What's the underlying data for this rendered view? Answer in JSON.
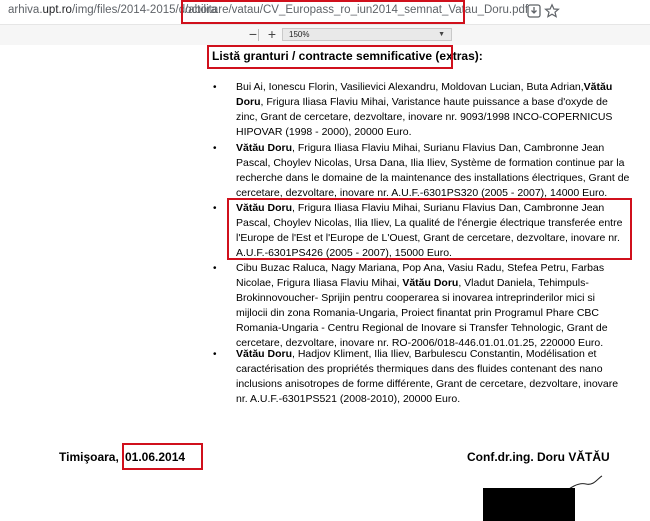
{
  "browser": {
    "url_host_plain": "arhiva.",
    "url_host_bold": "upt.ro",
    "url_path_plain": "/img/files/2014-2015/doctora",
    "url_path_highlighted": "/abilitare/vatau/CV_Europass_ro_iun2014_semnat_Vatau_Doru.pdf",
    "icons": [
      "download-icon",
      "star-icon"
    ]
  },
  "pdf_toolbar": {
    "zoom_out": "−",
    "zoom_in": "+",
    "zoom_value": "150%"
  },
  "document": {
    "heading": "Listă granturi / contracte semnificative (extras):",
    "grants": [
      {
        "lines": [
          [
            {
              "t": "Bui Ai, Ionescu Florin, Vasilievici Alexandru, Moldovan Lucian, Buta Adrian,",
              "b": false
            },
            {
              "t": "Vătău",
              "b": true
            }
          ],
          [
            {
              "t": "Doru",
              "b": true
            },
            {
              "t": ", Frigura Iliasa Flaviu Mihai, Varistance haute puissance a base d'oxyde de",
              "b": false
            }
          ],
          [
            {
              "t": "zinc, Grant de cercetare, dezvoltare, inovare nr. 9093/1998 INCO-COPERNICUS",
              "b": false
            }
          ],
          [
            {
              "t": "HIPOVAR (1998 - 2000), 20000 Euro.",
              "b": false
            }
          ]
        ]
      },
      {
        "lines": [
          [
            {
              "t": "Vătău Doru",
              "b": true
            },
            {
              "t": ", Frigura Iliasa Flaviu Mihai, Surianu Flavius Dan, Cambronne Jean",
              "b": false
            }
          ],
          [
            {
              "t": "Pascal, Choylev Nicolas, Ursa Dana, Ilia Iliev, Système de formation continue par la",
              "b": false
            }
          ],
          [
            {
              "t": "recherche dans le domaine de la maintenance des installations électriques, Grant de",
              "b": false
            }
          ],
          [
            {
              "t": "cercetare, dezvoltare, inovare nr.  A.U.F.-6301PS320 (2005 - 2007), 14000 Euro.",
              "b": false
            }
          ]
        ]
      },
      {
        "lines": [
          [
            {
              "t": "Vătău Doru",
              "b": true
            },
            {
              "t": ", Frigura Iliasa Flaviu Mihai, Surianu Flavius Dan, Cambronne Jean",
              "b": false
            }
          ],
          [
            {
              "t": "Pascal, Choylev Nicolas, Ilia Iliev, La qualité de l'énergie électrique transferée entre",
              "b": false
            }
          ],
          [
            {
              "t": "l'Europe de l'Est et l'Europe de L'Ouest, Grant de cercetare, dezvoltare, inovare nr.",
              "b": false
            }
          ],
          [
            {
              "t": "A.U.F.-6301PS426 (2005 - 2007), 15000 Euro.",
              "b": false
            }
          ]
        ]
      },
      {
        "lines": [
          [
            {
              "t": "Cibu Buzac Raluca, Nagy Mariana, Pop Ana, Vasiu Radu, Stefea Petru, Farbas",
              "b": false
            }
          ],
          [
            {
              "t": "Nicolae, Frigura Iliasa Flaviu Mihai, ",
              "b": false
            },
            {
              "t": "Vătău Doru",
              "b": true
            },
            {
              "t": ", Vladut Daniela, Tehimpuls-",
              "b": false
            }
          ],
          [
            {
              "t": "Brokinnovoucher- Sprijin pentru cooperarea si inovarea intreprinderilor mici si",
              "b": false
            }
          ],
          [
            {
              "t": "mijlocii din zona Romania-Ungaria, Proiect finantat prin Programul Phare CBC",
              "b": false
            }
          ],
          [
            {
              "t": "Romania-Ungaria - Centru Regional de Inovare si Transfer Tehnologic, Grant de",
              "b": false
            }
          ],
          [
            {
              "t": "cercetare, dezvoltare, inovare nr. RO-2006/018-446.01.01.01.25, 220000 Euro.",
              "b": false
            }
          ]
        ]
      },
      {
        "lines": [
          [
            {
              "t": "Vătău Doru",
              "b": true
            },
            {
              "t": ", Hadjov Kliment, Ilia Iliev, Barbulescu Constantin, Modélisation et",
              "b": false
            }
          ],
          [
            {
              "t": "caractérisation des propriétés thermiques dans des fluides contenant des nano",
              "b": false
            }
          ],
          [
            {
              "t": "inclusions anisotropes de forme différente, Grant de cercetare, dezvoltare, inovare",
              "b": false
            }
          ],
          [
            {
              "t": "nr. A.U.F.-6301PS521 (2008-2010), 20000 Euro.",
              "b": false
            }
          ]
        ]
      }
    ],
    "place": "Timişoara,",
    "date": "01.06.2014",
    "signature_name": "Conf.dr.ing. Doru VĂTĂU"
  },
  "colors": {
    "highlight": "#d0101c",
    "toolbar": "#f6f6f6",
    "redaction": "#000000"
  }
}
